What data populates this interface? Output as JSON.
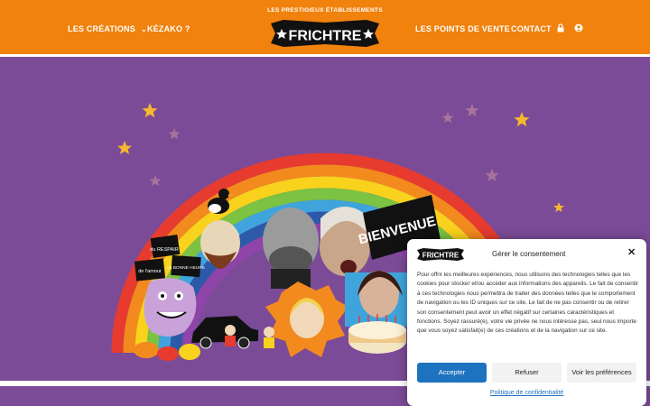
{
  "colors": {
    "header_bg": "#f0820d",
    "hero_bg": "#7b4b97",
    "accent_blue": "#1e73be",
    "star": "#f5b82e"
  },
  "nav": {
    "left": [
      {
        "label": "LES CRÉATIONS",
        "has_dropdown": true
      },
      {
        "label": "KÉZAKO ?"
      }
    ],
    "right": [
      {
        "label": "LES POINTS DE VENTE"
      },
      {
        "label": "CONTACT"
      }
    ],
    "icons": [
      "lock-icon",
      "user-icon"
    ]
  },
  "logo": {
    "tagline": "LES PRESTIGIEUX ÉTABLISSEMENTS",
    "name": "FRICHTRE"
  },
  "hero": {
    "sign_text": "BIENVENUE",
    "placards": [
      "du RESPAIR",
      "de l'amour",
      "du BONNE HEURE"
    ]
  },
  "consent": {
    "logo_text": "FRICHTRE",
    "title": "Gérer le consentement",
    "body": "Pour offrir les meilleures expériences, nous utilisons des technologies telles que les cookies pour stocker et/ou accéder aux informations des appareils. Le fait de consentir à ces technologies nous permettra de traiter des données telles que le comportement de navigation ou les ID uniques sur ce site. Le fait de ne pas consentir ou de retirer son consentement peut avoir un effet négatif sur certaines caractéristiques et fonctions. Soyez rassuré(e), votre vie privée ne nous intéresse pas, seul nous importe que vous soyez satisfait(e) de ces créations et de la navigation sur ce site.",
    "accept": "Accepter",
    "refuse": "Refuser",
    "preferences": "Voir les préférences",
    "privacy_link": "Politique de confidentialité"
  }
}
